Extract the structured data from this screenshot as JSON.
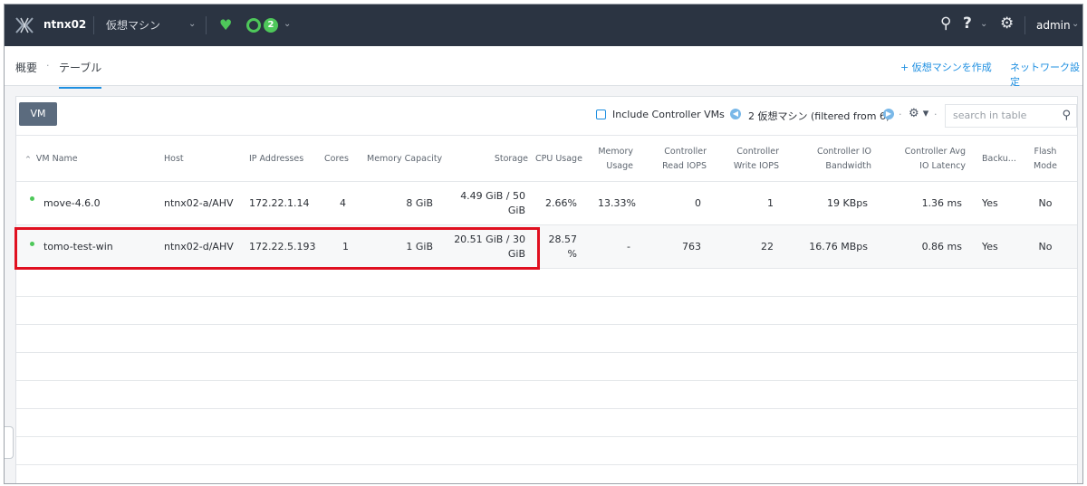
{
  "topbar": {
    "cluster": "ntnx02",
    "entity": "仮想マシン",
    "alert_count": "2",
    "user": "admin"
  },
  "subnav": {
    "overview": "概要",
    "separator": "·",
    "table": "テーブル",
    "create_vm": "+ 仮想マシンを作成",
    "network_config": "ネットワーク設定"
  },
  "toolbar": {
    "vm_button": "VM",
    "include_controller": "Include Controller VMs",
    "page_info": "2 仮想マシン (filtered from 6)",
    "search_placeholder": "search in table"
  },
  "table": {
    "columns": {
      "vm_name": "VM Name",
      "host": "Host",
      "ip": "IP Addresses",
      "cores": "Cores",
      "memory": "Memory Capacity",
      "storage": "Storage",
      "cpu": "CPU Usage",
      "mem_usage": "Memory Usage",
      "ctrl_read": "Controller Read IOPS",
      "ctrl_write": "Controller Write IOPS",
      "ctrl_bw": "Controller IO Bandwidth",
      "ctrl_lat": "Controller Avg IO Latency",
      "backup": "Backu...",
      "flash": "Flash Mode"
    },
    "rows": [
      {
        "name": "move-4.6.0",
        "host": "ntnx02-a/AHV",
        "ip": "172.22.1.14",
        "cores": "4",
        "memory": "8 GiB",
        "storage": "4.49 GiB / 50 GiB",
        "cpu": "2.66%",
        "mem_usage": "13.33%",
        "read_iops": "0",
        "write_iops": "1",
        "bandwidth": "19 KBps",
        "latency": "1.36 ms",
        "backup": "Yes",
        "flash": "No"
      },
      {
        "name": "tomo-test-win",
        "host": "ntnx02-d/AHV",
        "ip": "172.22.5.193",
        "cores": "1",
        "memory": "1 GiB",
        "storage": "20.51 GiB / 30 GiB",
        "cpu": "28.57 %",
        "mem_usage": "-",
        "read_iops": "763",
        "write_iops": "22",
        "bandwidth": "16.76 MBps",
        "latency": "0.86 ms",
        "backup": "Yes",
        "flash": "No"
      }
    ]
  },
  "colors": {
    "topbar": "#2b3442",
    "accent": "#1e8fe1",
    "status_green": "#4ec85a",
    "highlight_red": "#e01020"
  },
  "icons": [
    "nutanix-logo-icon",
    "heartbeat-icon",
    "alert-ring-icon",
    "search-icon",
    "help-icon",
    "gear-icon",
    "chevron-down-icon",
    "paginate-prev-icon",
    "paginate-next-icon"
  ]
}
